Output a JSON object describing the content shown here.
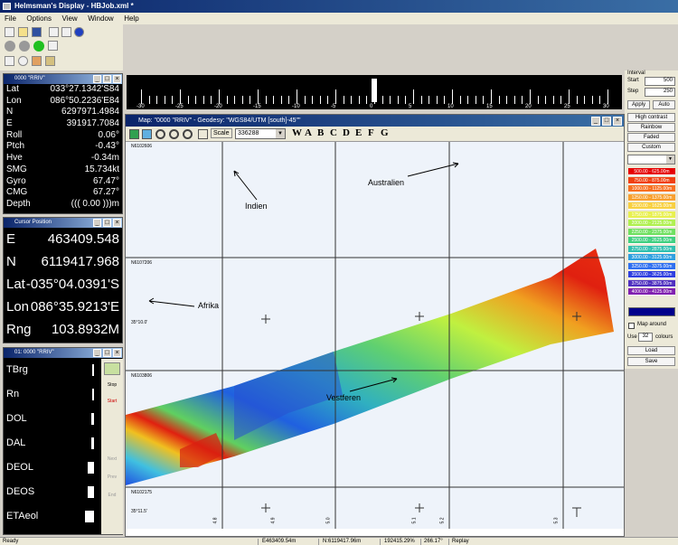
{
  "app": {
    "title": "Helmsman's Display - HBJob.xml *"
  },
  "menu": [
    "File",
    "Options",
    "View",
    "Window",
    "Help"
  ],
  "nav_panel": {
    "title": "0000 \"RRIV\"",
    "rows": [
      {
        "label": "Lat",
        "value": "033°27.1342'S84"
      },
      {
        "label": "Lon",
        "value": "086°50.2236'E84"
      },
      {
        "label": "N",
        "value": "6297971.4984"
      },
      {
        "label": "E",
        "value": "391917.7084"
      },
      {
        "label": "Roll",
        "value": "0.06°"
      },
      {
        "label": "Ptch",
        "value": "-0.43°"
      },
      {
        "label": "Hve",
        "value": "-0.34m"
      },
      {
        "label": "SMG",
        "value": "15.734kt"
      },
      {
        "label": "Gyro",
        "value": "67.47°"
      },
      {
        "label": "CMG",
        "value": "67.27°"
      },
      {
        "label": "Depth",
        "value": "((( 0.00 )))m"
      }
    ]
  },
  "cursor_panel": {
    "title": "Cursor Position",
    "rows": [
      {
        "label": "E",
        "value": "463409.548"
      },
      {
        "label": "N",
        "value": "6119417.968"
      },
      {
        "label": "Lat",
        "value": "-035°04.0391'S"
      },
      {
        "label": "Lon",
        "value": "086°35.9213'E"
      },
      {
        "label": "Rng",
        "value": "103.8932M"
      }
    ]
  },
  "bar_panel": {
    "title": "01: 0000 \"RRIV\"",
    "rows": [
      {
        "label": "TBrg",
        "level": 0.1
      },
      {
        "label": "Rn",
        "level": 0.1
      },
      {
        "label": "DOL",
        "level": 0.25
      },
      {
        "label": "DAL",
        "level": 0.25
      },
      {
        "label": "DEOL",
        "level": 0.6
      },
      {
        "label": "DEOS",
        "level": 0.6
      },
      {
        "label": "ETAeol",
        "level": 0.85
      }
    ],
    "side_buttons": [
      "Stop",
      "Start",
      "Next",
      "Prev",
      "End"
    ]
  },
  "ruler": {
    "labels": [
      "-30",
      "-25",
      "-20",
      "-15",
      "-10",
      "-5",
      "0",
      "5",
      "10",
      "15",
      "20",
      "25",
      "30"
    ]
  },
  "map": {
    "title": "Map: \"0000 \"RRIV\" - Geodesy: \"WGS84/UTM [south]-45\"\"",
    "scale_label": "Scale",
    "scale_value": "336288",
    "layer_buttons": [
      "W",
      "A",
      "B",
      "C",
      "D",
      "E",
      "F",
      "G"
    ],
    "grid_labels_n": [
      "N6102606",
      "N6107206",
      "N6103806",
      "N6102175"
    ],
    "grid_labels_lat": [
      "35°10.0'",
      "35°11.5'"
    ],
    "grid_labels_e": [
      "4.8",
      "4.9",
      "5.0",
      "5.1",
      "5.2",
      "5.3"
    ],
    "annotations": [
      {
        "label": "Indien"
      },
      {
        "label": "Australien"
      },
      {
        "label": "Afrika"
      },
      {
        "label": "Vestferen"
      }
    ]
  },
  "right_panel": {
    "interval_title": "Interval",
    "start_label": "Start",
    "start_value": "500",
    "step_label": "Step",
    "step_value": "250",
    "apply_label": "Apply",
    "auto_label": "Auto",
    "high_contrast": "High contrast",
    "rainbow": "Rainbow",
    "faded": "Faded",
    "custom": "Custom",
    "legend": [
      {
        "label": "500.00 - 625.00m",
        "color": "#e60000"
      },
      {
        "label": "750.00 - 875.00m",
        "color": "#f04010"
      },
      {
        "label": "1000.00 - 1125.00m",
        "color": "#f87020"
      },
      {
        "label": "1250.00 - 1375.00m",
        "color": "#f8a030"
      },
      {
        "label": "1500.00 - 1625.00m",
        "color": "#f8d040"
      },
      {
        "label": "1750.00 - 1875.00m",
        "color": "#e8f050"
      },
      {
        "label": "2000.00 - 2125.00m",
        "color": "#b0f050"
      },
      {
        "label": "2250.00 - 2375.00m",
        "color": "#70e060"
      },
      {
        "label": "2500.00 - 2625.00m",
        "color": "#40d080"
      },
      {
        "label": "2750.00 - 2875.00m",
        "color": "#30c0b0"
      },
      {
        "label": "3000.00 - 3125.00m",
        "color": "#30a0e0"
      },
      {
        "label": "3250.00 - 3375.00m",
        "color": "#3070f0"
      },
      {
        "label": "3500.00 - 3625.00m",
        "color": "#3040e0"
      },
      {
        "label": "3750.00 - 3875.00m",
        "color": "#5030c0"
      },
      {
        "label": "4000.00 - 4125.00m",
        "color": "#8020b0"
      }
    ],
    "map_around": "Map around",
    "use_label": "Use",
    "use_value": "32",
    "colors_label": "colours",
    "load": "Load",
    "save": "Save"
  },
  "status": {
    "ready": "Ready",
    "e": "E463409.54m",
    "n": "N:6119417.96m",
    "zoom": "192415.29%",
    "hdg": "266.17°",
    "mode": "Replay"
  }
}
